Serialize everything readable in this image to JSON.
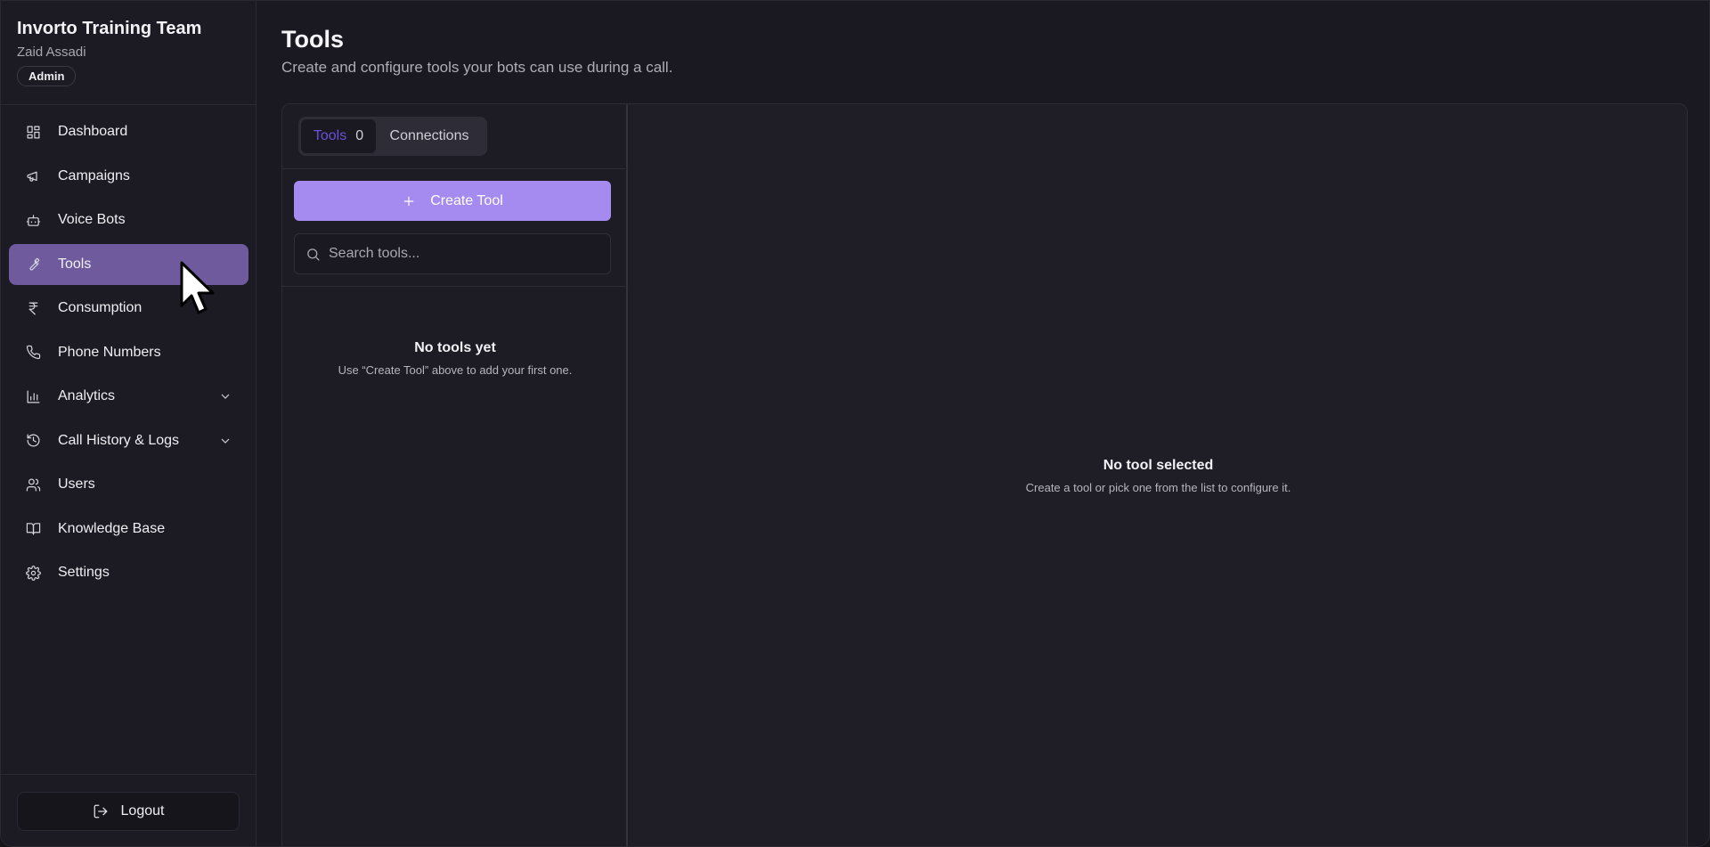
{
  "org": {
    "name": "Invorto Training Team",
    "user": "Zaid Assadi",
    "role": "Admin"
  },
  "sidebar": {
    "items": [
      {
        "label": "Dashboard",
        "icon": "dashboard-icon"
      },
      {
        "label": "Campaigns",
        "icon": "megaphone-icon"
      },
      {
        "label": "Voice Bots",
        "icon": "bot-icon"
      },
      {
        "label": "Tools",
        "icon": "wrench-icon",
        "active": true
      },
      {
        "label": "Consumption",
        "icon": "rupee-icon"
      },
      {
        "label": "Phone Numbers",
        "icon": "phone-icon"
      },
      {
        "label": "Analytics",
        "icon": "bar-chart-icon",
        "expandable": true
      },
      {
        "label": "Call History & Logs",
        "icon": "history-icon",
        "expandable": true
      },
      {
        "label": "Users",
        "icon": "users-icon"
      },
      {
        "label": "Knowledge Base",
        "icon": "book-icon"
      },
      {
        "label": "Settings",
        "icon": "gear-icon"
      }
    ],
    "logout_label": "Logout"
  },
  "page": {
    "title": "Tools",
    "subtitle": "Create and configure tools your bots can use during a call."
  },
  "tabs": {
    "tools_label": "Tools",
    "tools_count": "0",
    "connections_label": "Connections"
  },
  "create_button_label": "Create Tool",
  "search": {
    "placeholder": "Search tools..."
  },
  "empty_list": {
    "title": "No tools yet",
    "description": "Use “Create Tool” above to add your first one."
  },
  "detail": {
    "title": "No tool selected",
    "description": "Create a tool or pick one from the list to configure it."
  },
  "colors": {
    "accent": "#a58bf0",
    "active_nav": "#6f5a9e",
    "active_tab_text": "#6a52d9"
  }
}
